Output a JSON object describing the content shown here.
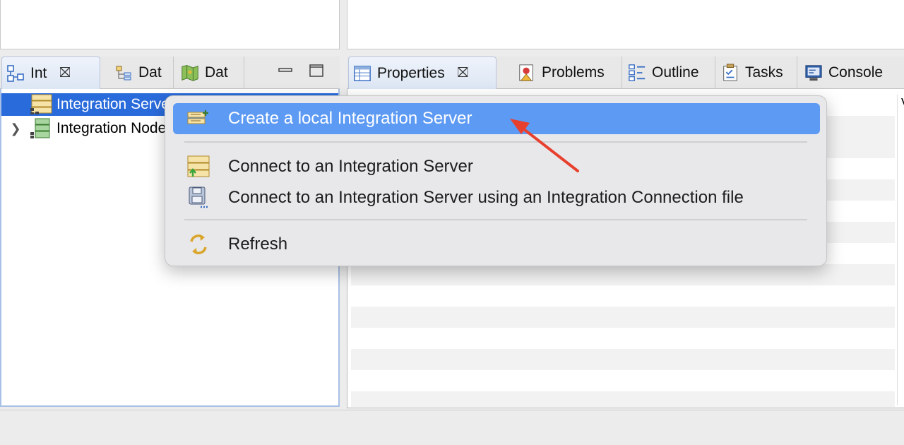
{
  "left_tabs": [
    {
      "label": "Int",
      "icon": "integration-explorer-icon",
      "active": true
    },
    {
      "label": "Dat",
      "icon": "data-design-icon",
      "active": false
    },
    {
      "label": "Dat",
      "icon": "data-source-icon",
      "active": false
    }
  ],
  "right_tabs": [
    {
      "label": "Properties",
      "icon": "properties-icon",
      "active": true
    },
    {
      "label": "Problems",
      "icon": "problems-icon",
      "active": false
    },
    {
      "label": "Outline",
      "icon": "outline-icon",
      "active": false
    },
    {
      "label": "Tasks",
      "icon": "tasks-icon",
      "active": false
    },
    {
      "label": "Console",
      "icon": "console-icon",
      "active": false
    }
  ],
  "tree": [
    {
      "label": "Integration Servers",
      "icon": "integration-servers-icon",
      "selected": true,
      "expandable": false
    },
    {
      "label": "Integration Nodes",
      "icon": "integration-nodes-icon",
      "selected": false,
      "expandable": true
    }
  ],
  "right_view": {
    "column_header": "V"
  },
  "context_menu": {
    "items": [
      {
        "label": "Create a local Integration Server",
        "icon": "create-server-icon",
        "highlighted": true
      },
      {
        "label": "Connect to an Integration Server",
        "icon": "connect-server-icon",
        "highlighted": false
      },
      {
        "label": "Connect to an Integration Server using an Integration Connection file",
        "icon": "connection-file-icon",
        "highlighted": false
      },
      {
        "label": "Refresh",
        "icon": "refresh-icon",
        "highlighted": false
      }
    ]
  },
  "colors": {
    "selection": "#2a6bdc",
    "menu_highlight": "#5d9af3",
    "annotation_arrow": "#e8402e"
  }
}
